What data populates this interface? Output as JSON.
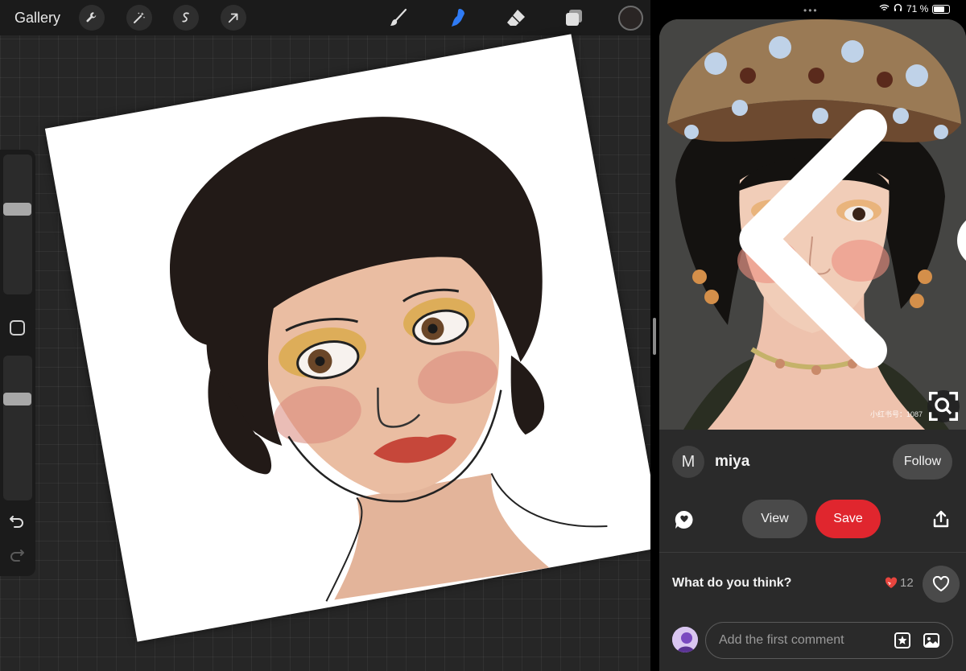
{
  "drawing_app": {
    "gallery_label": "Gallery",
    "tools": [
      "wrench-icon",
      "magic-wand-icon",
      "selection-icon",
      "transform-arrow-icon",
      "brush-icon",
      "smudge-icon",
      "eraser-icon",
      "layers-icon"
    ],
    "active_tool": "smudge-icon",
    "active_tool_color": "#2f7bf5",
    "current_color": "#2a2524",
    "brush_size_level": 0.62,
    "opacity_level": 0.72
  },
  "status_bar": {
    "battery_text": "71 %",
    "battery_level": 0.71
  },
  "pin_app": {
    "watermark": "小红书号：1087",
    "profile": {
      "avatar_letter": "M",
      "username": "miya",
      "follow_label": "Follow"
    },
    "actions": {
      "view_label": "View",
      "save_label": "Save",
      "save_color": "#e0262e"
    },
    "engagement": {
      "prompt": "What do you think?",
      "reaction_count": "12"
    },
    "comment": {
      "placeholder": "Add the first comment"
    }
  }
}
